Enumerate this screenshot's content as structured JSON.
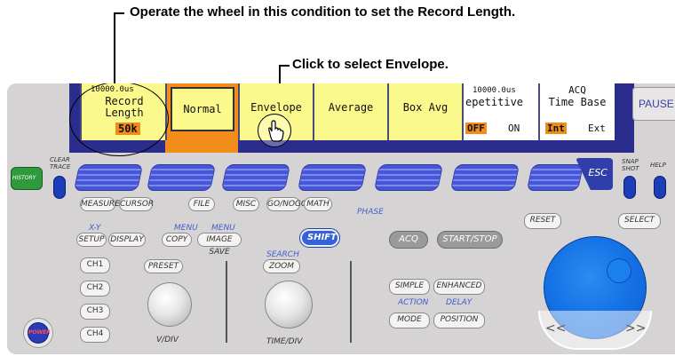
{
  "callouts": {
    "record_length": "Operate the wheel in this condition to set the Record Length.",
    "envelope": "Click to select Envelope."
  },
  "screen": {
    "softkeys": {
      "record_length": {
        "time": "10000.0us",
        "label": "Record Length",
        "value": "50k"
      },
      "normal": "Normal",
      "envelope": "Envelope",
      "average": "Average",
      "box_avg": "Box Avg",
      "repetitive": {
        "time": "10000.0us",
        "label": "epetitive",
        "off": "OFF",
        "on": "ON"
      },
      "acq": {
        "title": "ACQ",
        "label": "Time Base",
        "int": "Int",
        "ext": "Ext"
      }
    },
    "pause_label": "PAUSE"
  },
  "panel": {
    "history": "HISTORY",
    "clear_trace": "CLEAR TRACE",
    "esc": "ESC",
    "snap_shot": "SNAP SHOT",
    "help": "HELP",
    "measure": "MEASURE",
    "cursor": "CURSOR",
    "file": "FILE",
    "misc": "MISC",
    "gonogo": "GO/NOGO",
    "math": "MATH",
    "phase": "PHASE",
    "xy": "X-Y",
    "menu1": "MENU",
    "menu2": "MENU",
    "setup": "SETUP",
    "display": "DISPLAY",
    "copy": "COPY",
    "image_save": "IMAGE SAVE",
    "shift": "SHIFT",
    "acq": "ACQ",
    "start_stop": "START/STOP",
    "reset": "RESET",
    "select": "SELECT",
    "search": "SEARCH",
    "zoom": "ZOOM",
    "preset": "PRESET",
    "ch1": "CH1",
    "ch2": "CH2",
    "ch3": "CH3",
    "ch4": "CH4",
    "simple": "SIMPLE",
    "enhanced": "ENHANCED",
    "action": "ACTION",
    "delay": "DELAY",
    "mode": "MODE",
    "position": "POSITION",
    "vdiv": "V/DIV",
    "tdiv": "TIME/DIV",
    "power": "POWER",
    "wheel_left": "<<",
    "wheel_right": ">>"
  }
}
